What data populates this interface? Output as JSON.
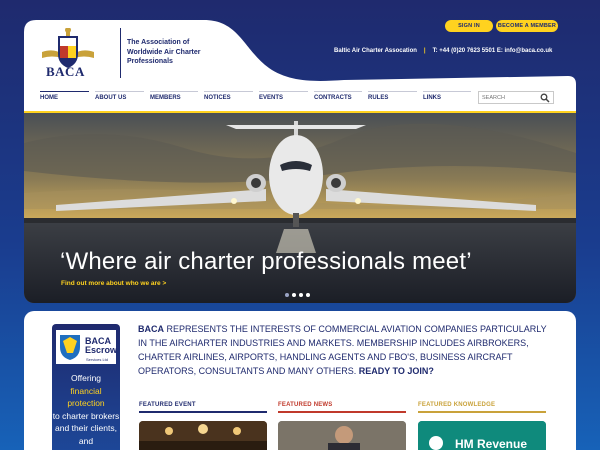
{
  "header": {
    "logo_text": "BACA",
    "tagline": "The Association of Worldwide Air Charter Professionals",
    "signin_label": "SIGN IN",
    "member_label": "BECOME A MEMBER",
    "org_name": "Baltic Air Charter Assocation",
    "phone": "T: +44 (0)20 7623 5501",
    "email": "E: info@baca.co.uk"
  },
  "nav": {
    "items": [
      "HOME",
      "ABOUT US",
      "MEMBERS",
      "NOTICES",
      "EVENTS",
      "CONTRACTS",
      "RULES",
      "LINKS"
    ],
    "search_placeholder": "SEARCH"
  },
  "hero": {
    "title": "‘Where air charter professionals meet’",
    "link": "Find out more about who we are >",
    "slide_count": 4,
    "active_slide": 1
  },
  "escrow": {
    "name": "BACA Escrow",
    "sub": "Services Ltd",
    "text_pre": "Offering",
    "text_hl": "financial protection",
    "text_post": "to charter brokers and their clients, and"
  },
  "intro": {
    "lead": "BACA",
    "body": " represents the interests of commercial aviation companies particularly in the aircharter industries and markets. Membership includes airbrokers, charter airlines, airports, handling agents and FBO's, business aircraft operators, consultants and many others. ",
    "cta": "Ready to join?"
  },
  "featured": {
    "event_label": "FEATURED EVENT",
    "news_label": "FEATURED NEWS",
    "knowledge_label": "FEATURED KNOWLEDGE",
    "knowledge_image_text": "HM Revenue"
  },
  "colors": {
    "navy": "#1f2a6e",
    "yellow": "#ffd21f",
    "event": "#1f2a6e",
    "news": "#c0392b",
    "knowledge": "#c9a23a"
  }
}
